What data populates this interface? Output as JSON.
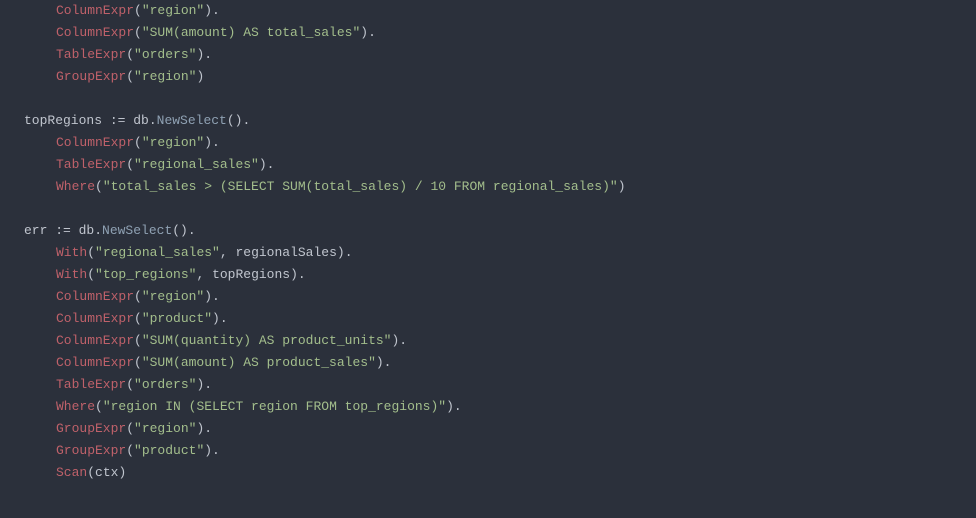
{
  "code": {
    "lines": [
      {
        "indent": 1,
        "tokens": [
          {
            "t": "fn",
            "v": "ColumnExpr"
          },
          {
            "t": "paren",
            "v": "("
          },
          {
            "t": "str",
            "v": "\"region\""
          },
          {
            "t": "paren",
            "v": ")."
          }
        ]
      },
      {
        "indent": 1,
        "tokens": [
          {
            "t": "fn",
            "v": "ColumnExpr"
          },
          {
            "t": "paren",
            "v": "("
          },
          {
            "t": "str",
            "v": "\"SUM(amount) AS total_sales\""
          },
          {
            "t": "paren",
            "v": ")."
          }
        ]
      },
      {
        "indent": 1,
        "tokens": [
          {
            "t": "fn",
            "v": "TableExpr"
          },
          {
            "t": "paren",
            "v": "("
          },
          {
            "t": "str",
            "v": "\"orders\""
          },
          {
            "t": "paren",
            "v": ")."
          }
        ]
      },
      {
        "indent": 1,
        "tokens": [
          {
            "t": "fn",
            "v": "GroupExpr"
          },
          {
            "t": "paren",
            "v": "("
          },
          {
            "t": "str",
            "v": "\"region\""
          },
          {
            "t": "paren",
            "v": ")"
          }
        ]
      },
      {
        "blank": true
      },
      {
        "indent": 0,
        "tokens": [
          {
            "t": "ident",
            "v": "topRegions "
          },
          {
            "t": "op",
            "v": ":= "
          },
          {
            "t": "ident",
            "v": "db."
          },
          {
            "t": "method",
            "v": "NewSelect"
          },
          {
            "t": "paren",
            "v": "()."
          }
        ]
      },
      {
        "indent": 1,
        "tokens": [
          {
            "t": "fn",
            "v": "ColumnExpr"
          },
          {
            "t": "paren",
            "v": "("
          },
          {
            "t": "str",
            "v": "\"region\""
          },
          {
            "t": "paren",
            "v": ")."
          }
        ]
      },
      {
        "indent": 1,
        "tokens": [
          {
            "t": "fn",
            "v": "TableExpr"
          },
          {
            "t": "paren",
            "v": "("
          },
          {
            "t": "str",
            "v": "\"regional_sales\""
          },
          {
            "t": "paren",
            "v": ")."
          }
        ]
      },
      {
        "indent": 1,
        "tokens": [
          {
            "t": "fn",
            "v": "Where"
          },
          {
            "t": "paren",
            "v": "("
          },
          {
            "t": "str",
            "v": "\"total_sales > (SELECT SUM(total_sales) / 10 FROM regional_sales)\""
          },
          {
            "t": "paren",
            "v": ")"
          }
        ]
      },
      {
        "blank": true
      },
      {
        "indent": 0,
        "tokens": [
          {
            "t": "ident",
            "v": "err "
          },
          {
            "t": "op",
            "v": ":= "
          },
          {
            "t": "ident",
            "v": "db."
          },
          {
            "t": "method",
            "v": "NewSelect"
          },
          {
            "t": "paren",
            "v": "()."
          }
        ]
      },
      {
        "indent": 1,
        "tokens": [
          {
            "t": "fn",
            "v": "With"
          },
          {
            "t": "paren",
            "v": "("
          },
          {
            "t": "str",
            "v": "\"regional_sales\""
          },
          {
            "t": "paren",
            "v": ", "
          },
          {
            "t": "ident",
            "v": "regionalSales"
          },
          {
            "t": "paren",
            "v": ")."
          }
        ]
      },
      {
        "indent": 1,
        "tokens": [
          {
            "t": "fn",
            "v": "With"
          },
          {
            "t": "paren",
            "v": "("
          },
          {
            "t": "str",
            "v": "\"top_regions\""
          },
          {
            "t": "paren",
            "v": ", "
          },
          {
            "t": "ident",
            "v": "topRegions"
          },
          {
            "t": "paren",
            "v": ")."
          }
        ]
      },
      {
        "indent": 1,
        "tokens": [
          {
            "t": "fn",
            "v": "ColumnExpr"
          },
          {
            "t": "paren",
            "v": "("
          },
          {
            "t": "str",
            "v": "\"region\""
          },
          {
            "t": "paren",
            "v": ")."
          }
        ]
      },
      {
        "indent": 1,
        "tokens": [
          {
            "t": "fn",
            "v": "ColumnExpr"
          },
          {
            "t": "paren",
            "v": "("
          },
          {
            "t": "str",
            "v": "\"product\""
          },
          {
            "t": "paren",
            "v": ")."
          }
        ]
      },
      {
        "indent": 1,
        "tokens": [
          {
            "t": "fn",
            "v": "ColumnExpr"
          },
          {
            "t": "paren",
            "v": "("
          },
          {
            "t": "str",
            "v": "\"SUM(quantity) AS product_units\""
          },
          {
            "t": "paren",
            "v": ")."
          }
        ]
      },
      {
        "indent": 1,
        "tokens": [
          {
            "t": "fn",
            "v": "ColumnExpr"
          },
          {
            "t": "paren",
            "v": "("
          },
          {
            "t": "str",
            "v": "\"SUM(amount) AS product_sales\""
          },
          {
            "t": "paren",
            "v": ")."
          }
        ]
      },
      {
        "indent": 1,
        "tokens": [
          {
            "t": "fn",
            "v": "TableExpr"
          },
          {
            "t": "paren",
            "v": "("
          },
          {
            "t": "str",
            "v": "\"orders\""
          },
          {
            "t": "paren",
            "v": ")."
          }
        ]
      },
      {
        "indent": 1,
        "tokens": [
          {
            "t": "fn",
            "v": "Where"
          },
          {
            "t": "paren",
            "v": "("
          },
          {
            "t": "str",
            "v": "\"region IN (SELECT region FROM top_regions)\""
          },
          {
            "t": "paren",
            "v": ")."
          }
        ]
      },
      {
        "indent": 1,
        "tokens": [
          {
            "t": "fn",
            "v": "GroupExpr"
          },
          {
            "t": "paren",
            "v": "("
          },
          {
            "t": "str",
            "v": "\"region\""
          },
          {
            "t": "paren",
            "v": ")."
          }
        ]
      },
      {
        "indent": 1,
        "tokens": [
          {
            "t": "fn",
            "v": "GroupExpr"
          },
          {
            "t": "paren",
            "v": "("
          },
          {
            "t": "str",
            "v": "\"product\""
          },
          {
            "t": "paren",
            "v": ")."
          }
        ]
      },
      {
        "indent": 1,
        "tokens": [
          {
            "t": "fn",
            "v": "Scan"
          },
          {
            "t": "paren",
            "v": "("
          },
          {
            "t": "ident",
            "v": "ctx"
          },
          {
            "t": "paren",
            "v": ")"
          }
        ]
      }
    ]
  }
}
